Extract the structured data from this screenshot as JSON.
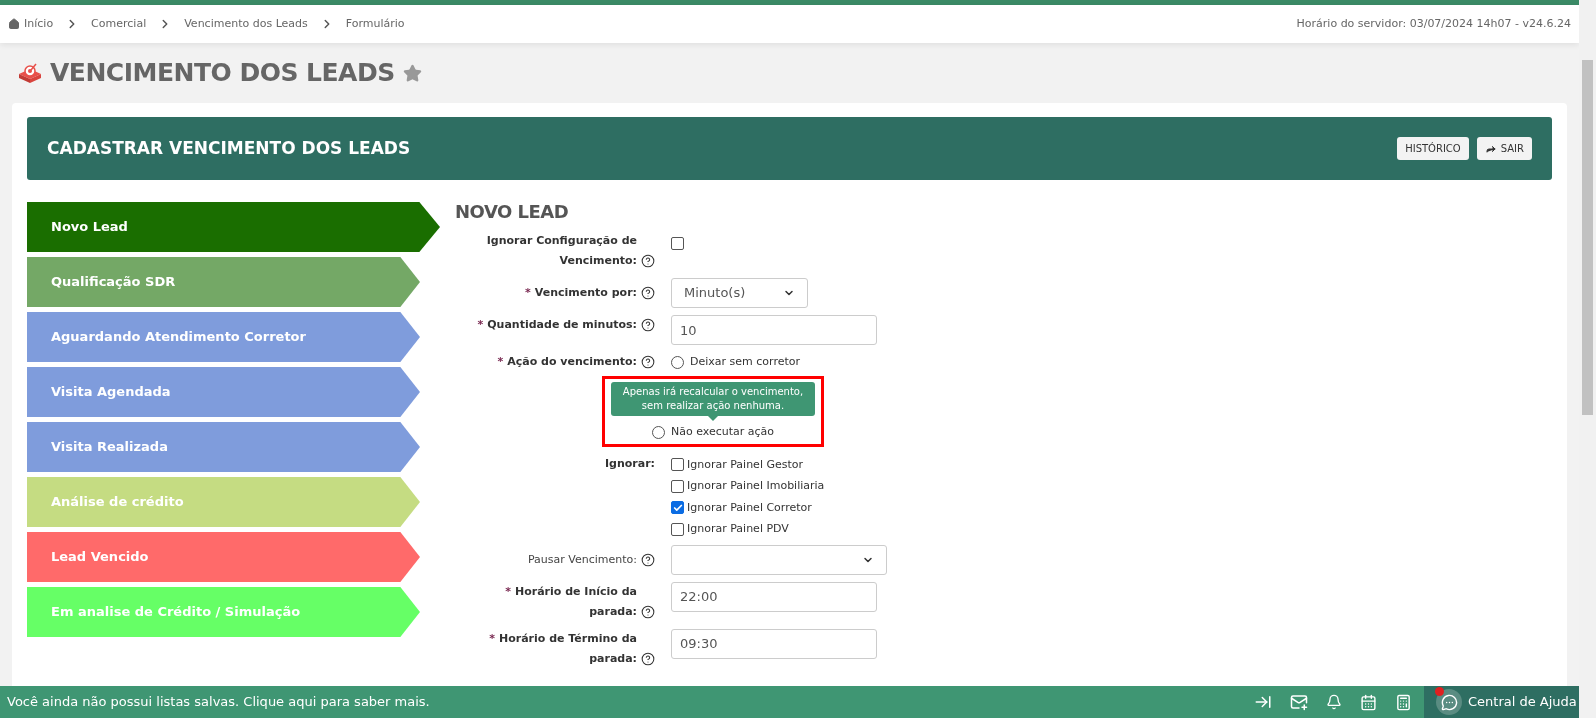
{
  "breadcrumb": {
    "items": [
      "Início",
      "Comercial",
      "Vencimento dos Leads",
      "Formulário"
    ],
    "server_time": "Horário do servidor: 03/07/2024 14h07 - v24.6.24"
  },
  "page": {
    "title": "VENCIMENTO DOS LEADS",
    "favorite": false
  },
  "card": {
    "title": "CADASTRAR VENCIMENTO DOS LEADS",
    "buttons": [
      {
        "label": "HISTÓRICO",
        "kind": "plain"
      },
      {
        "label": "SAIR",
        "kind": "exit"
      }
    ]
  },
  "steps": [
    {
      "label": "Novo Lead",
      "color": "#1a6e00",
      "selected": true
    },
    {
      "label": "Qualificação SDR",
      "color": "#74a866",
      "selected": false
    },
    {
      "label": "Aguardando Atendimento Corretor",
      "color": "#7f9cdc",
      "selected": false
    },
    {
      "label": "Visita Agendada",
      "color": "#7f9cdc",
      "selected": false
    },
    {
      "label": "Visita Realizada",
      "color": "#7f9cdc",
      "selected": false
    },
    {
      "label": "Análise de crédito",
      "color": "#c5dc82",
      "selected": false
    },
    {
      "label": "Lead Vencido",
      "color": "#ff6a6a",
      "selected": false
    },
    {
      "label": "Em analise de Crédito / Simulação",
      "color": "#66ff66",
      "selected": false
    }
  ],
  "form": {
    "title": "NOVO LEAD",
    "fields": [
      {
        "kind": "checkbox",
        "label": "Ignorar Configuração de Vencimento:",
        "help": true,
        "checked": false
      },
      {
        "kind": "select",
        "mark": "*",
        "label": "Vencimento por:",
        "help": true,
        "value": "Minuto(s)"
      },
      {
        "kind": "text",
        "mark": "*",
        "label": "Quantidade de minutos:",
        "help": true,
        "value": "10"
      },
      {
        "kind": "radio",
        "mark": "*",
        "label": "Ação do vencimento:",
        "help": true,
        "options": [
          {
            "label": "Deixar sem corretor",
            "selected": false
          },
          {
            "label": "Não executar ação",
            "selected": false,
            "tooltip": "Apenas irá recalcular o vencimento, sem realizar ação nenhuma."
          }
        ]
      },
      {
        "kind": "checkboxes",
        "label": "Ignorar:",
        "options": [
          {
            "label": "Ignorar Painel Gestor",
            "checked": false
          },
          {
            "label": "Ignorar Painel Imobiliaria",
            "checked": false
          },
          {
            "label": "Ignorar Painel Corretor",
            "checked": true
          },
          {
            "label": "Ignorar Painel PDV",
            "checked": false
          }
        ]
      },
      {
        "kind": "select",
        "label": "Pausar Vencimento:",
        "help": true,
        "plain": true
      },
      {
        "kind": "text",
        "mark": "*",
        "label": "Horário de Início da parada:",
        "help": true,
        "value": "22:00"
      },
      {
        "kind": "text",
        "mark": "*",
        "label": "Horário de Término da parada:",
        "help": true,
        "value": "09:30"
      }
    ]
  },
  "bottom_bar": {
    "message": "Você ainda não possui listas salvas. Clique aqui para saber mais.",
    "help_label": "Central de Ajuda",
    "help_notification": true
  }
}
